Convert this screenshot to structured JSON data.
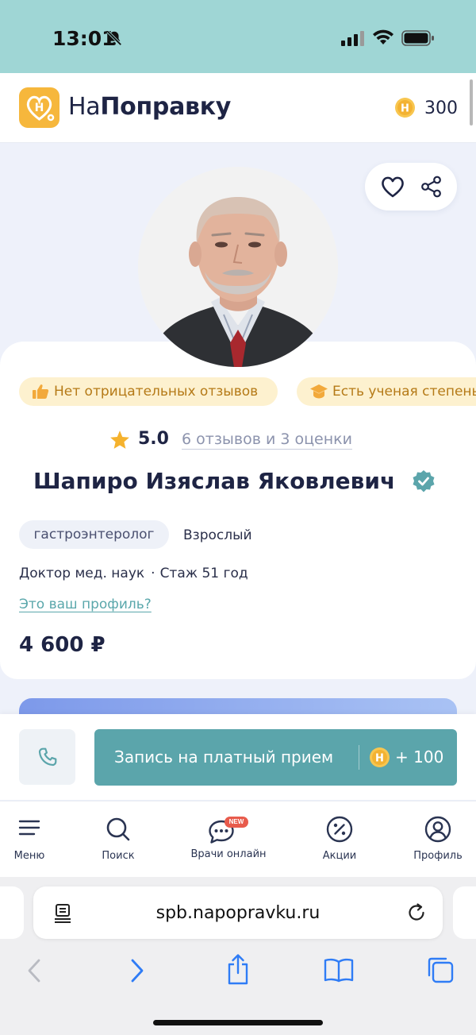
{
  "status_bar": {
    "time": "13:01"
  },
  "header": {
    "logo_letter": "Н",
    "logo_prefix": "На",
    "logo_bold": "Поправку",
    "coin_letter": "Н",
    "coins": "300"
  },
  "doctor": {
    "badges": [
      "Нет отрицательных отзывов",
      "Есть ученая степень"
    ],
    "rating": "5.0",
    "reviews_link": "6 отзывов и 3 оценки",
    "name": "Шапиро Изяслав Яковлевич",
    "specialty": "гастроэнтеролог",
    "age_group": "Взрослый",
    "degree": "Доктор мед. наук",
    "experience": "Стаж 51 год",
    "profile_link": "Это ваш профиль?",
    "price": "4 600 ₽"
  },
  "actions": {
    "book_label": "Запись на платный прием",
    "bonus": "+ 100",
    "coin_letter": "Н"
  },
  "bottom_nav": {
    "items": [
      {
        "label": "Меню",
        "icon": "menu-icon"
      },
      {
        "label": "Поиск",
        "icon": "search-icon"
      },
      {
        "label": "Врачи онлайн",
        "icon": "chat-icon"
      },
      {
        "label": "Акции",
        "icon": "percent-icon"
      },
      {
        "label": "Профиль",
        "icon": "user-icon"
      }
    ],
    "new_badge": "NEW"
  },
  "browser": {
    "url": "spb.napopravku.ru"
  },
  "colors": {
    "brand_teal": "#5ba5ab",
    "logo_yellow": "#f6b73c",
    "chip_bg": "#fdf1cf",
    "status_bar_bg": "#9fd6d5"
  }
}
